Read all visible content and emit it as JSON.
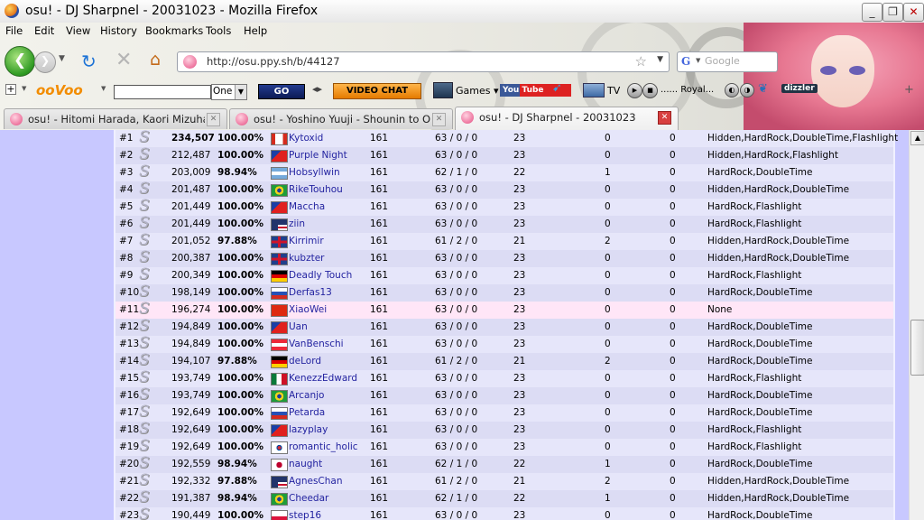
{
  "window": {
    "title": "osu! - DJ Sharpnel - 20031023 - Mozilla Firefox",
    "controls": [
      "_",
      "❐",
      "✕"
    ]
  },
  "menu": [
    "File",
    "Edit",
    "View",
    "History",
    "Bookmarks",
    "Tools",
    "Help"
  ],
  "address": {
    "url": "http://osu.ppy.sh/b/44127"
  },
  "search": {
    "placeholder": "Google"
  },
  "toolbar": {
    "oovoo": "ooVoo",
    "select_value": "One",
    "go_label": "GO",
    "video_chat_label": "VIDEO CHAT",
    "games_label": "Games",
    "social_label": "You Tube",
    "tv_label": "TV",
    "radio_label": "...... Royal...",
    "dizzler_label": "dizzler"
  },
  "tabs": [
    {
      "label": "osu! - Hitomi Harada, Kaori Mizuhashi, ..."
    },
    {
      "label": "osu! - Yoshino Yuuji - Shounin to Ooka..."
    },
    {
      "label": "osu! - DJ Sharpnel - 20031023"
    }
  ],
  "colors": {
    "page_bg": "#c8c8ff",
    "row_even": "#e6e6fa",
    "row_odd": "#dcdcf4",
    "row_highlight": "#ffe6f7",
    "player_link": "#2323a0"
  },
  "scores": [
    {
      "rank": "#1",
      "score": "234,507",
      "acc": "100.00%",
      "flag": "canada",
      "player": "Kytoxid",
      "combo": "161",
      "hits": "63 / 0 / 0",
      "miss": "23",
      "geki": "0",
      "katu": "0",
      "mods": "Hidden,HardRock,DoubleTime,Flashlight"
    },
    {
      "rank": "#2",
      "score": "212,487",
      "acc": "100.00%",
      "flag": "taiwan",
      "player": "Purple Night",
      "combo": "161",
      "hits": "63 / 0 / 0",
      "miss": "23",
      "geki": "0",
      "katu": "0",
      "mods": "Hidden,HardRock,Flashlight"
    },
    {
      "rank": "#3",
      "score": "203,009",
      "acc": "98.94%",
      "flag": "argentina",
      "player": "Hobsyllwin",
      "combo": "161",
      "hits": "62 / 1 / 0",
      "miss": "22",
      "geki": "1",
      "katu": "0",
      "mods": "HardRock,DoubleTime"
    },
    {
      "rank": "#4",
      "score": "201,487",
      "acc": "100.00%",
      "flag": "brazil",
      "player": "RikeTouhou",
      "combo": "161",
      "hits": "63 / 0 / 0",
      "miss": "23",
      "geki": "0",
      "katu": "0",
      "mods": "Hidden,HardRock,DoubleTime"
    },
    {
      "rank": "#5",
      "score": "201,449",
      "acc": "100.00%",
      "flag": "taiwan",
      "player": "Maccha",
      "combo": "161",
      "hits": "63 / 0 / 0",
      "miss": "23",
      "geki": "0",
      "katu": "0",
      "mods": "HardRock,Flashlight"
    },
    {
      "rank": "#6",
      "score": "201,449",
      "acc": "100.00%",
      "flag": "usa",
      "player": "ziin",
      "combo": "161",
      "hits": "63 / 0 / 0",
      "miss": "23",
      "geki": "0",
      "katu": "0",
      "mods": "HardRock,Flashlight"
    },
    {
      "rank": "#7",
      "score": "201,052",
      "acc": "97.88%",
      "flag": "uk",
      "player": "Kirrimir",
      "combo": "161",
      "hits": "61 / 2 / 0",
      "miss": "21",
      "geki": "2",
      "katu": "0",
      "mods": "Hidden,HardRock,DoubleTime"
    },
    {
      "rank": "#8",
      "score": "200,387",
      "acc": "100.00%",
      "flag": "uk",
      "player": "kubzter",
      "combo": "161",
      "hits": "63 / 0 / 0",
      "miss": "23",
      "geki": "0",
      "katu": "0",
      "mods": "Hidden,HardRock,DoubleTime"
    },
    {
      "rank": "#9",
      "score": "200,349",
      "acc": "100.00%",
      "flag": "germany",
      "player": "Deadly Touch",
      "combo": "161",
      "hits": "63 / 0 / 0",
      "miss": "23",
      "geki": "0",
      "katu": "0",
      "mods": "HardRock,Flashlight"
    },
    {
      "rank": "#10",
      "score": "198,149",
      "acc": "100.00%",
      "flag": "russia",
      "player": "Derfas13",
      "combo": "161",
      "hits": "63 / 0 / 0",
      "miss": "23",
      "geki": "0",
      "katu": "0",
      "mods": "HardRock,DoubleTime"
    },
    {
      "rank": "#11",
      "score": "196,274",
      "acc": "100.00%",
      "flag": "china",
      "player": "XiaoWei",
      "combo": "161",
      "hits": "63 / 0 / 0",
      "miss": "23",
      "geki": "0",
      "katu": "0",
      "mods": "None",
      "highlight": true
    },
    {
      "rank": "#12",
      "score": "194,849",
      "acc": "100.00%",
      "flag": "taiwan",
      "player": "Uan",
      "combo": "161",
      "hits": "63 / 0 / 0",
      "miss": "23",
      "geki": "0",
      "katu": "0",
      "mods": "HardRock,DoubleTime"
    },
    {
      "rank": "#13",
      "score": "194,849",
      "acc": "100.00%",
      "flag": "austria",
      "player": "VanBenschi",
      "combo": "161",
      "hits": "63 / 0 / 0",
      "miss": "23",
      "geki": "0",
      "katu": "0",
      "mods": "HardRock,DoubleTime"
    },
    {
      "rank": "#14",
      "score": "194,107",
      "acc": "97.88%",
      "flag": "germany",
      "player": "deLord",
      "combo": "161",
      "hits": "61 / 2 / 0",
      "miss": "21",
      "geki": "2",
      "katu": "0",
      "mods": "HardRock,DoubleTime"
    },
    {
      "rank": "#15",
      "score": "193,749",
      "acc": "100.00%",
      "flag": "mexico",
      "player": "KenezzEdward",
      "combo": "161",
      "hits": "63 / 0 / 0",
      "miss": "23",
      "geki": "0",
      "katu": "0",
      "mods": "HardRock,Flashlight"
    },
    {
      "rank": "#16",
      "score": "193,749",
      "acc": "100.00%",
      "flag": "brazil",
      "player": "Arcanjo",
      "combo": "161",
      "hits": "63 / 0 / 0",
      "miss": "23",
      "geki": "0",
      "katu": "0",
      "mods": "HardRock,DoubleTime"
    },
    {
      "rank": "#17",
      "score": "192,649",
      "acc": "100.00%",
      "flag": "russia",
      "player": "Petarda",
      "combo": "161",
      "hits": "63 / 0 / 0",
      "miss": "23",
      "geki": "0",
      "katu": "0",
      "mods": "HardRock,DoubleTime"
    },
    {
      "rank": "#18",
      "score": "192,649",
      "acc": "100.00%",
      "flag": "taiwan",
      "player": "lazyplay",
      "combo": "161",
      "hits": "63 / 0 / 0",
      "miss": "23",
      "geki": "0",
      "katu": "0",
      "mods": "HardRock,Flashlight"
    },
    {
      "rank": "#19",
      "score": "192,649",
      "acc": "100.00%",
      "flag": "korea",
      "player": "romantic_holic",
      "combo": "161",
      "hits": "63 / 0 / 0",
      "miss": "23",
      "geki": "0",
      "katu": "0",
      "mods": "HardRock,Flashlight"
    },
    {
      "rank": "#20",
      "score": "192,559",
      "acc": "98.94%",
      "flag": "japan",
      "player": "naught",
      "combo": "161",
      "hits": "62 / 1 / 0",
      "miss": "22",
      "geki": "1",
      "katu": "0",
      "mods": "HardRock,DoubleTime"
    },
    {
      "rank": "#21",
      "score": "192,332",
      "acc": "97.88%",
      "flag": "usa",
      "player": "AgnesChan",
      "combo": "161",
      "hits": "61 / 2 / 0",
      "miss": "21",
      "geki": "2",
      "katu": "0",
      "mods": "Hidden,HardRock,DoubleTime"
    },
    {
      "rank": "#22",
      "score": "191,387",
      "acc": "98.94%",
      "flag": "brazil",
      "player": "Cheedar",
      "combo": "161",
      "hits": "62 / 1 / 0",
      "miss": "22",
      "geki": "1",
      "katu": "0",
      "mods": "Hidden,HardRock,DoubleTime"
    },
    {
      "rank": "#23",
      "score": "190,449",
      "acc": "100.00%",
      "flag": "poland",
      "player": "step16",
      "combo": "161",
      "hits": "63 / 0 / 0",
      "miss": "23",
      "geki": "0",
      "katu": "0",
      "mods": "HardRock,DoubleTime"
    }
  ]
}
